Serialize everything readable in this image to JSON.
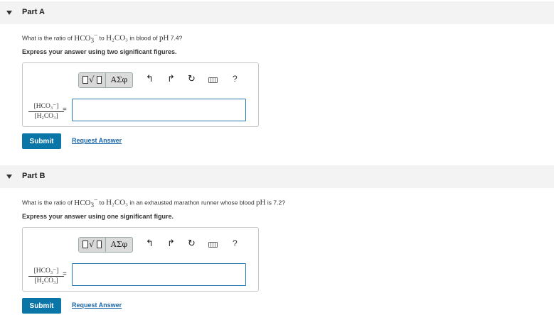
{
  "partA": {
    "title": "Part A",
    "question_pre": "What is the ratio of",
    "question_chem1": "HCO",
    "question_chem1_sub": "3",
    "question_chem1_sup": "−",
    "question_to": "to",
    "question_chem2": "H₂CO₃",
    "question_post": "in blood of",
    "question_ph": "pH",
    "question_end": "7.4?",
    "instruction": "Express your answer using two significant figures.",
    "frac_num": "[HCO₃⁻]",
    "frac_den": "[H₂CO₃]",
    "equals": "=",
    "answer_value": "",
    "submit_label": "Submit",
    "request_label": "Request Answer"
  },
  "partB": {
    "title": "Part B",
    "question_pre": "What is the ratio of",
    "question_chem1": "HCO",
    "question_chem1_sub": "3",
    "question_chem1_sup": "−",
    "question_to": "to",
    "question_chem2": "H₂CO₃",
    "question_post": "in an exhausted marathon runner whose blood",
    "question_ph": "pH",
    "question_end": "is 7.2?",
    "instruction": "Express your answer using one significant figure.",
    "frac_num": "[HCO₃⁻]",
    "frac_den": "[H₂CO₃]",
    "equals": "=",
    "answer_value": "",
    "submit_label": "Submit",
    "request_label": "Request Answer"
  },
  "toolbar": {
    "greek_label": "ΑΣφ",
    "radical_glyph": "√",
    "undo_glyph": "↰",
    "redo_glyph": "↱",
    "reset_glyph": "↻",
    "help_glyph": "?"
  }
}
